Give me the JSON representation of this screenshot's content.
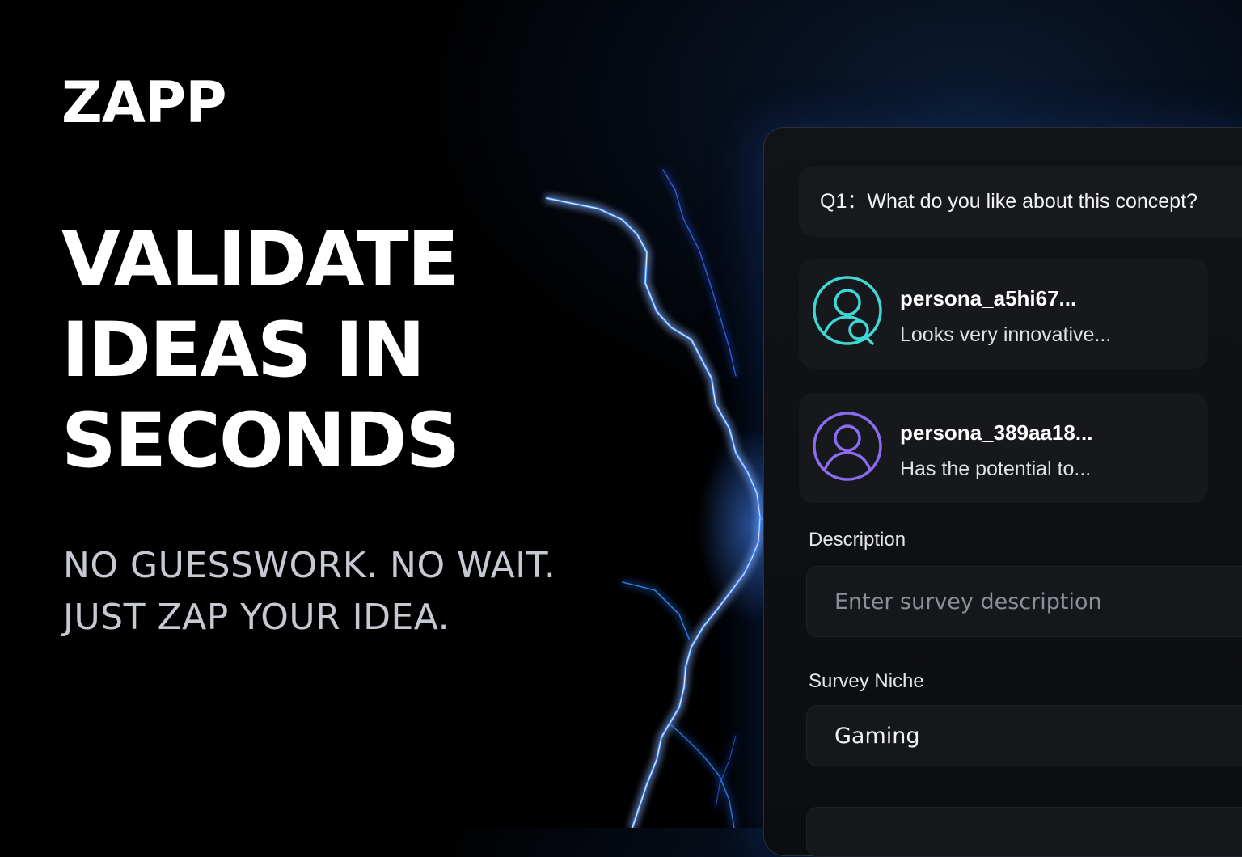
{
  "brand": {
    "logo_text": "ZAPP"
  },
  "hero": {
    "headline_lines": [
      "VALIDATE",
      "IDEAS IN",
      "SECONDS"
    ],
    "subline_lines": [
      "NO GUESSWORK. NO WAIT.",
      "JUST ZAP YOUR IDEA."
    ]
  },
  "survey": {
    "question": "Q1：What do you like about this concept?",
    "responses": [
      {
        "persona": "persona_a5hi67...",
        "snippet": "Looks very innovative...",
        "icon": "user-search-icon",
        "color": "#3fd6d6"
      },
      {
        "persona": "persona_389aa18...",
        "snippet": "Has the potential to...",
        "icon": "user-icon",
        "color": "#8b6cf0"
      }
    ],
    "description": {
      "label": "Description",
      "value": "",
      "placeholder": "Enter survey description"
    },
    "niche": {
      "label": "Survey Niche",
      "value": "Gaming"
    }
  },
  "colors": {
    "accent_lightning": "#2f7bff",
    "persona_teal": "#3fd6d6",
    "persona_purple": "#8b6cf0"
  }
}
